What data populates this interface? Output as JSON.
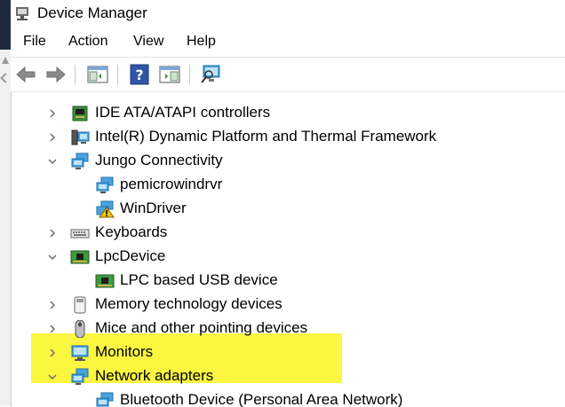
{
  "window": {
    "title": "Device Manager"
  },
  "menu": [
    "File",
    "Action",
    "View",
    "Help"
  ],
  "toolbar": {
    "buttons": [
      {
        "icon": "back-arrow-icon"
      },
      {
        "icon": "forward-arrow-icon"
      },
      {
        "icon": "show-hide-console-tree-icon"
      },
      {
        "icon": "help-icon"
      },
      {
        "icon": "properties-pane-icon"
      },
      {
        "icon": "scan-hardware-changes-icon"
      }
    ]
  },
  "tree": {
    "highlight_color": "#fbf640",
    "items": [
      {
        "label": "IDE ATA/ATAPI controllers",
        "depth": 0,
        "expanded": false,
        "icon": "ide-controller-icon"
      },
      {
        "label": "Intel(R) Dynamic Platform and Thermal Framework",
        "depth": 0,
        "expanded": false,
        "icon": "thermal-framework-icon"
      },
      {
        "label": "Jungo Connectivity",
        "depth": 0,
        "expanded": true,
        "icon": "network-monitor-icon"
      },
      {
        "label": "pemicrowindrvr",
        "depth": 1,
        "icon": "network-monitor-icon"
      },
      {
        "label": "WinDriver",
        "depth": 1,
        "icon": "network-monitor-warning-icon"
      },
      {
        "label": "Keyboards",
        "depth": 0,
        "expanded": false,
        "icon": "keyboard-icon"
      },
      {
        "label": "LpcDevice",
        "depth": 0,
        "expanded": true,
        "icon": "circuit-board-icon"
      },
      {
        "label": "LPC based USB device",
        "depth": 1,
        "icon": "circuit-board-icon"
      },
      {
        "label": "Memory technology devices",
        "depth": 0,
        "expanded": false,
        "icon": "memory-device-icon"
      },
      {
        "label": "Mice and other pointing devices",
        "depth": 0,
        "expanded": false,
        "icon": "mouse-icon"
      },
      {
        "label": "Monitors",
        "depth": 0,
        "expanded": false,
        "icon": "monitor-icon"
      },
      {
        "label": "Network adapters",
        "depth": 0,
        "expanded": true,
        "icon": "network-monitor-icon"
      },
      {
        "label": "Bluetooth Device (Personal Area Network)",
        "depth": 1,
        "icon": "network-monitor-icon"
      }
    ]
  }
}
